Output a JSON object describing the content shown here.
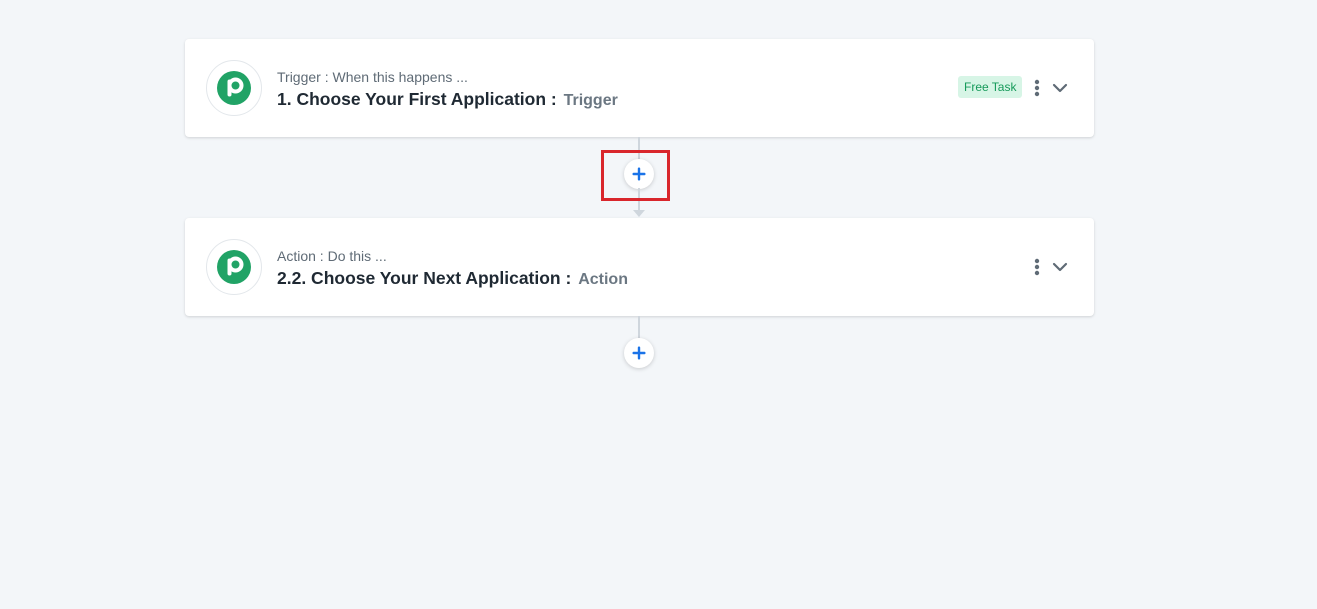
{
  "steps": [
    {
      "subtitle": "Trigger : When this happens ...",
      "title": "1. Choose Your First Application :",
      "type": "Trigger",
      "badge": "Free Task",
      "icon": "pabbly-logo-icon"
    },
    {
      "subtitle": "Action : Do this ...",
      "title": "2.2. Choose Your Next Application :",
      "type": "Action",
      "icon": "pabbly-logo-icon"
    }
  ],
  "icons": {
    "more": "kebab-menu-icon",
    "expand": "chevron-down-icon",
    "add": "plus-icon"
  },
  "colors": {
    "background": "#f3f6f9",
    "brand_green": "#21a366",
    "add_blue": "#1a73e8",
    "badge_bg": "#d7f5e6",
    "badge_text": "#169a5a",
    "highlight": "#d9262c"
  }
}
